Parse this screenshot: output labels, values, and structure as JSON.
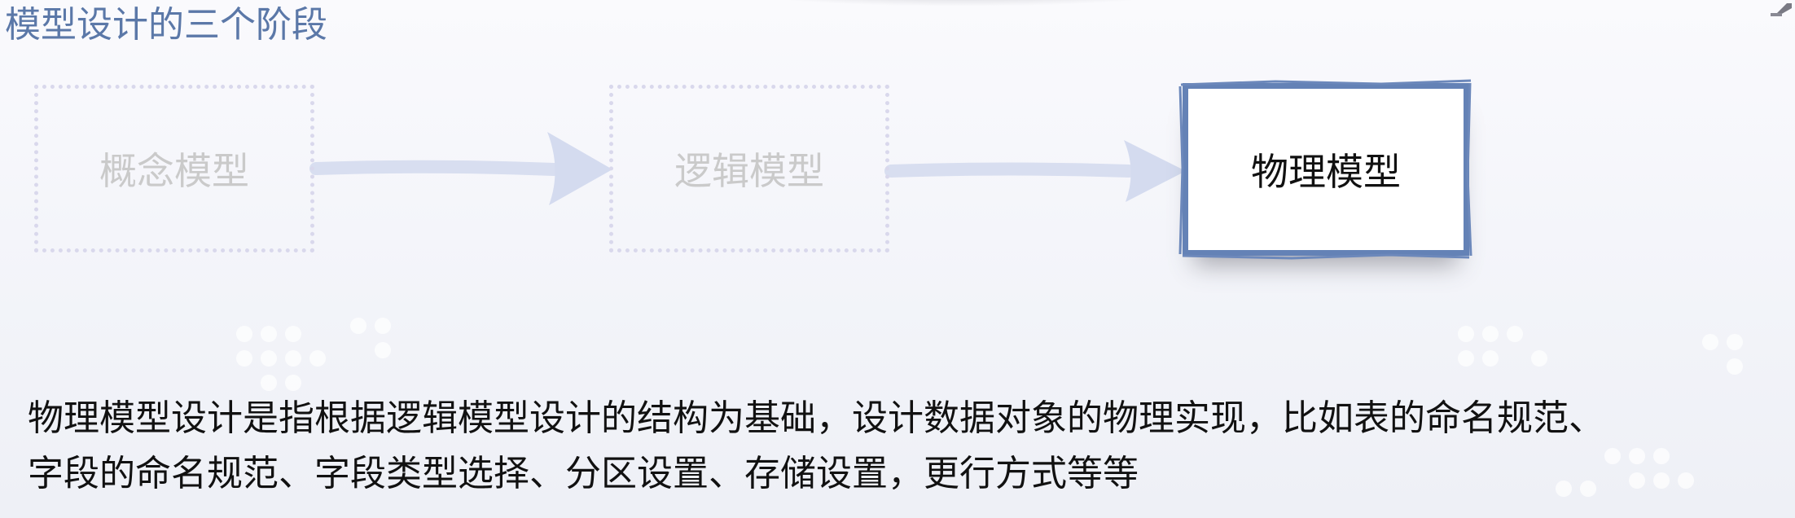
{
  "slide": {
    "title": "模型设计的三个阶段",
    "stages": [
      {
        "label": "概念模型",
        "state": "inactive"
      },
      {
        "label": "逻辑模型",
        "state": "inactive"
      },
      {
        "label": "物理模型",
        "state": "active"
      }
    ],
    "description_lines": [
      "物理模型设计是指根据逻辑模型设计的结构为基础，设计数据对象的物理实现，比如表的命名规范、",
      "字段的命名规范、字段类型选择、分区设置、存储设置，更行方式等等"
    ]
  },
  "colors": {
    "title": "#5b78a8",
    "active_border": "#6482b6",
    "inactive_border": "#d9d8ec",
    "inactive_text": "#cacaca",
    "arrow": "#d8def0"
  },
  "icons": {
    "arrow_1": "right-arrow-icon",
    "arrow_2": "right-arrow-icon",
    "corner": "pen-icon"
  }
}
